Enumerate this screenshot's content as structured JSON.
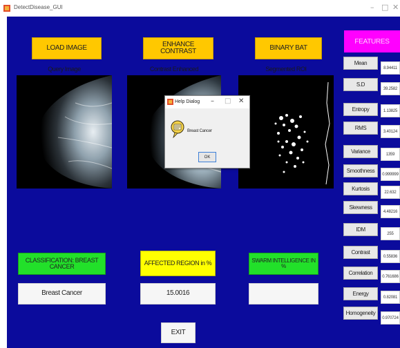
{
  "window": {
    "title": "DetectDisease_GUI"
  },
  "buttons": {
    "load": "LOAD IMAGE",
    "enhance": "ENHANCE CONTRAST",
    "bat": "BINARY BAT",
    "exit": "EXIT"
  },
  "captions": {
    "query": "Query Image",
    "enhanced": "Contrast Enhanced",
    "roi": "Segmented ROI"
  },
  "results": {
    "classification_label": "CLASSIFICATION: BREAST CANCER",
    "classification_value": "Breast Cancer",
    "affected_label": "AFFECTED REGION in %",
    "affected_value": "15.0016",
    "swarm_label": "SWARM INTELLIGENCE IN %",
    "swarm_value": ""
  },
  "features": {
    "header": "FEATURES",
    "items": [
      {
        "label": "Mean",
        "value": "8.94411"
      },
      {
        "label": "S.D",
        "value": "39.2582"
      },
      {
        "label": "Entropy",
        "value": "1.13825"
      },
      {
        "label": "RMS",
        "value": "3.40124"
      },
      {
        "label": "Variance",
        "value": "1359"
      },
      {
        "label": "Smoothness",
        "value": "0.999999"
      },
      {
        "label": "Kurtosis",
        "value": "22.632"
      },
      {
        "label": "Skewness",
        "value": "4.48216"
      },
      {
        "label": "IDM",
        "value": "255"
      },
      {
        "label": "Contrast",
        "value": "0.55836"
      },
      {
        "label": "Correlation",
        "value": "0.761686"
      },
      {
        "label": "Energy",
        "value": "0.82081"
      },
      {
        "label": "Homogeneity",
        "value": "0.970724"
      }
    ]
  },
  "dialog": {
    "title": "Help Dialog",
    "message": "Breast Cancer",
    "ok": "OK"
  },
  "colors": {
    "background": "#0b0b9c",
    "button_yellow": "#ffc800",
    "button_green": "#22e02a",
    "label_yellow": "#ffff00",
    "features_header": "#ff00ff"
  }
}
